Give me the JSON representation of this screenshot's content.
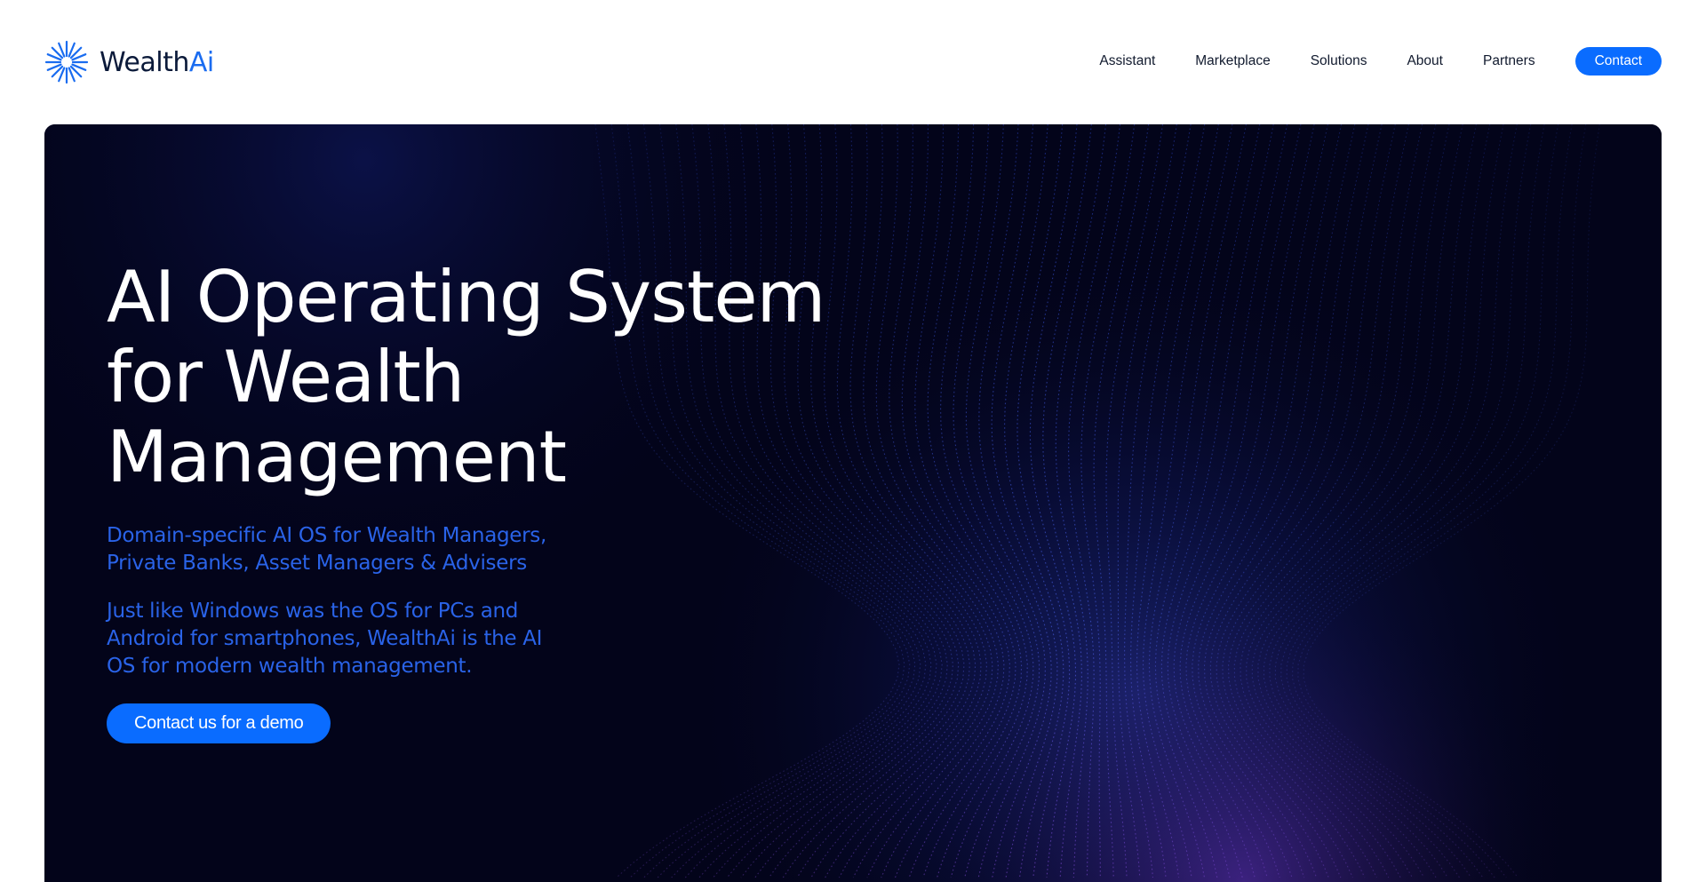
{
  "brand": {
    "name_main": "Wealth",
    "name_accent": "Ai"
  },
  "nav": {
    "items": [
      "Assistant",
      "Marketplace",
      "Solutions",
      "About",
      "Partners"
    ],
    "contact_label": "Contact"
  },
  "hero": {
    "title_line1": "AI Operating System",
    "title_line2": "for Wealth",
    "title_line3": "Management",
    "subtitle": "Domain-specific AI OS for Wealth Managers, Private Banks, Asset Managers & Advisers",
    "description": "Just like Windows was the OS for PCs and Android for smartphones, WealthAi is the AI OS for modern wealth management.",
    "cta_label": "Contact us for a demo"
  },
  "colors": {
    "accent": "#0a6cff",
    "brand_dark": "#0b1a3a",
    "hero_background": "#03041a",
    "hero_text_accent": "#2a63e8"
  },
  "icons": {
    "logo": "starburst-logo-icon"
  }
}
